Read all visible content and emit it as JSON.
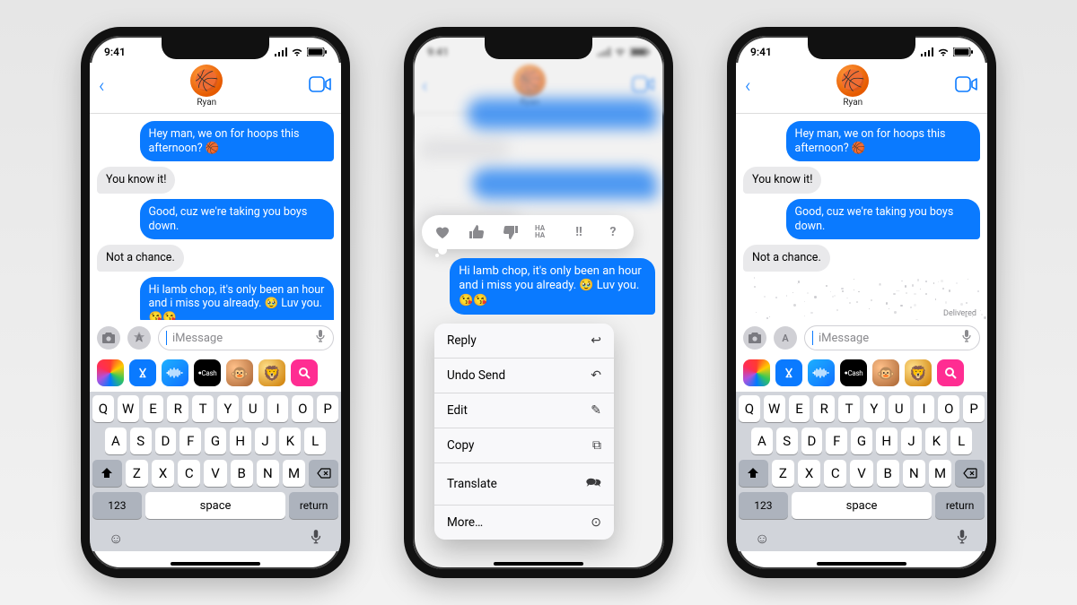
{
  "status": {
    "time": "9:41"
  },
  "header": {
    "contact_name": "Ryan",
    "avatar_emoji": "🏀"
  },
  "messages": {
    "m1": "Hey man, we on for hoops this afternoon? 🏀",
    "m2": "You know it!",
    "m3": "Good, cuz we're taking you boys down.",
    "m4": "Not a chance.",
    "m5": "Hi lamb chop, it's only been an hour and i miss you already. 🥹 Luv you. 😘😘",
    "delivered": "Delivered"
  },
  "compose": {
    "placeholder": "iMessage",
    "apple_cash_label": "Cash"
  },
  "keyboard": {
    "row1": [
      "Q",
      "W",
      "E",
      "R",
      "T",
      "Y",
      "U",
      "I",
      "O",
      "P"
    ],
    "row2": [
      "A",
      "S",
      "D",
      "F",
      "G",
      "H",
      "J",
      "K",
      "L"
    ],
    "row3": [
      "Z",
      "X",
      "C",
      "V",
      "B",
      "N",
      "M"
    ],
    "num": "123",
    "space": "space",
    "return": "return"
  },
  "tapbacks": {
    "haha": "HA HA",
    "exclaim": "!!",
    "question": "?"
  },
  "context_menu": {
    "reply": "Reply",
    "undo_send": "Undo Send",
    "edit": "Edit",
    "copy": "Copy",
    "translate": "Translate",
    "more": "More…"
  }
}
